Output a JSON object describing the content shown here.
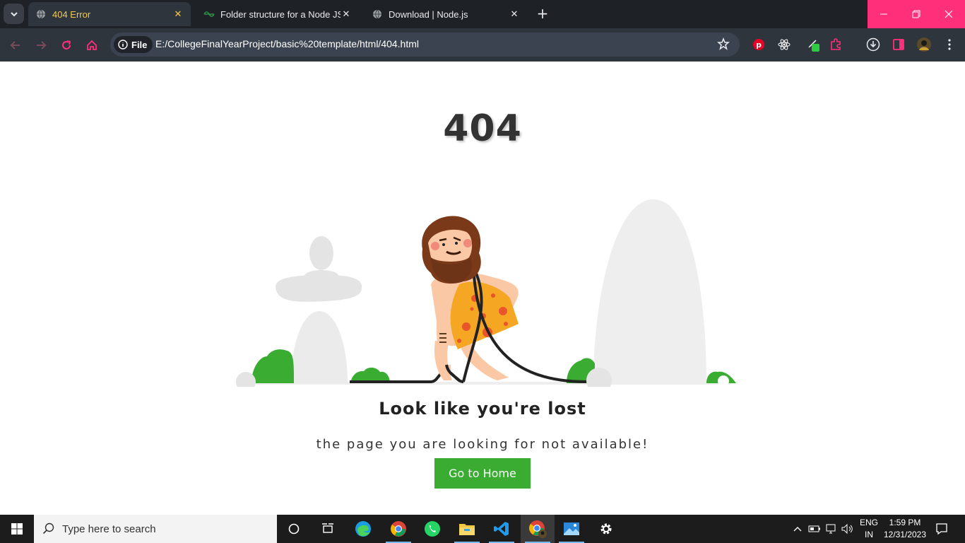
{
  "browser": {
    "tabs": [
      {
        "title": "404 Error",
        "favicon": "globe-icon",
        "active": true
      },
      {
        "title": "Folder structure for a Node JS p",
        "favicon": "gfg-icon",
        "active": false
      },
      {
        "title": "Download | Node.js",
        "favicon": "globe-icon",
        "active": false
      }
    ],
    "new_tab_label": "+",
    "omnibox": {
      "scheme_label": "File",
      "url": "E:/CollegeFinalYearProject/basic%20template/html/404.html"
    },
    "accent_color": "#ff2f7a"
  },
  "page": {
    "code": "404",
    "title": "Look like you're lost",
    "subtitle": "the page you are looking for not available!",
    "button_label": "Go to Home",
    "button_color": "#39ac31"
  },
  "taskbar": {
    "search_placeholder": "Type here to search",
    "apps": [
      "cortana-icon",
      "task-view-icon",
      "edge-icon",
      "chrome-icon",
      "whatsapp-icon",
      "file-explorer-icon",
      "vscode-icon",
      "chrome-profile-icon",
      "photos-icon",
      "settings-icon"
    ],
    "language": "ENG",
    "region": "IN",
    "time": "1:59 PM",
    "date": "12/31/2023"
  }
}
